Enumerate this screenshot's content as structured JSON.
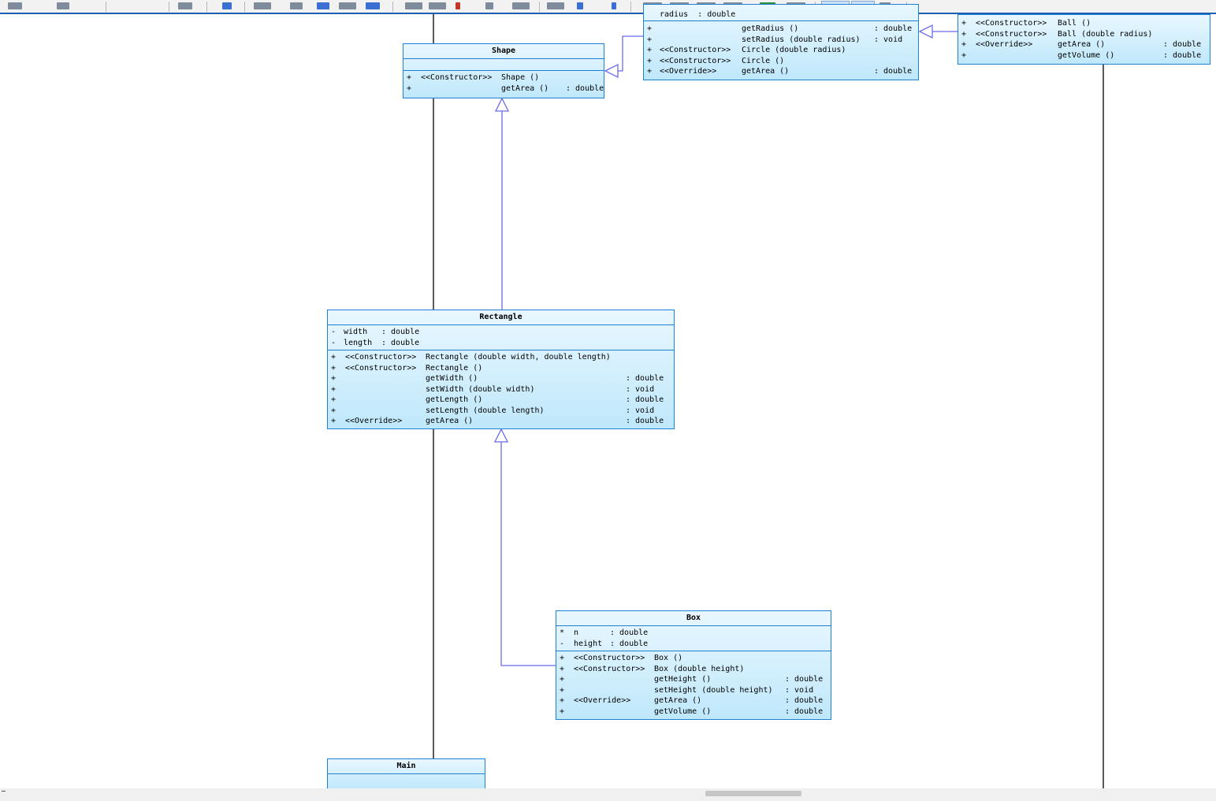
{
  "colors": {
    "class_border": "#1e7fd6",
    "class_fill_top": "#e9f7ff",
    "class_fill_bottom": "#bfe8fb",
    "inheritance_line": "#6b6bea",
    "lifeline": "#000000"
  },
  "classes": {
    "shape": {
      "name": "Shape",
      "attributes": [],
      "operations": [
        {
          "vis": "+",
          "stereo": "<<Constructor>>",
          "sig": "Shape ()",
          "type": ""
        },
        {
          "vis": "+",
          "stereo": "",
          "sig": "getArea ()",
          "type": ": double"
        }
      ]
    },
    "circle": {
      "name": "",
      "partial_attribute": "radius  : double",
      "operations": [
        {
          "vis": "+",
          "stereo": "",
          "sig": "getRadius ()",
          "type": ": double"
        },
        {
          "vis": "+",
          "stereo": "",
          "sig": "setRadius (double radius)",
          "type": ": void"
        },
        {
          "vis": "+",
          "stereo": "<<Constructor>>",
          "sig": "Circle (double radius)",
          "type": ""
        },
        {
          "vis": "+",
          "stereo": "<<Constructor>>",
          "sig": "Circle ()",
          "type": ""
        },
        {
          "vis": "+",
          "stereo": "<<Override>>",
          "sig": "getArea ()",
          "type": ": double"
        }
      ]
    },
    "ball": {
      "name": "",
      "operations": [
        {
          "vis": "+",
          "stereo": "<<Constructor>>",
          "sig": "Ball ()",
          "type": ""
        },
        {
          "vis": "+",
          "stereo": "<<Constructor>>",
          "sig": "Ball (double radius)",
          "type": ""
        },
        {
          "vis": "+",
          "stereo": "<<Override>>",
          "sig": "getArea ()",
          "type": ": double"
        },
        {
          "vis": "+",
          "stereo": "",
          "sig": "getVolume ()",
          "type": ": double"
        }
      ]
    },
    "rectangle": {
      "name": "Rectangle",
      "attributes": [
        {
          "vis": "-",
          "name": "width",
          "type": ": double"
        },
        {
          "vis": "-",
          "name": "length",
          "type": ": double"
        }
      ],
      "operations": [
        {
          "vis": "+",
          "stereo": "<<Constructor>>",
          "sig": "Rectangle (double width, double length)",
          "type": ""
        },
        {
          "vis": "+",
          "stereo": "<<Constructor>>",
          "sig": "Rectangle ()",
          "type": ""
        },
        {
          "vis": "+",
          "stereo": "",
          "sig": "getWidth ()",
          "type": ": double"
        },
        {
          "vis": "+",
          "stereo": "",
          "sig": "setWidth (double width)",
          "type": ": void"
        },
        {
          "vis": "+",
          "stereo": "",
          "sig": "getLength ()",
          "type": ": double"
        },
        {
          "vis": "+",
          "stereo": "",
          "sig": "setLength (double length)",
          "type": ": void"
        },
        {
          "vis": "+",
          "stereo": "<<Override>>",
          "sig": "getArea ()",
          "type": ": double"
        }
      ]
    },
    "box": {
      "name": "Box",
      "attributes": [
        {
          "vis": "*",
          "name": "n",
          "type": ": double"
        },
        {
          "vis": "-",
          "name": "height",
          "type": ": double"
        }
      ],
      "operations": [
        {
          "vis": "+",
          "stereo": "<<Constructor>>",
          "sig": "Box ()",
          "type": ""
        },
        {
          "vis": "+",
          "stereo": "<<Constructor>>",
          "sig": "Box (double height)",
          "type": ""
        },
        {
          "vis": "+",
          "stereo": "",
          "sig": "getHeight ()",
          "type": ": double"
        },
        {
          "vis": "+",
          "stereo": "",
          "sig": "setHeight (double height)",
          "type": ": void"
        },
        {
          "vis": "+",
          "stereo": "<<Override>>",
          "sig": "getArea ()",
          "type": ": double"
        },
        {
          "vis": "+",
          "stereo": "",
          "sig": "getVolume ()",
          "type": ": double"
        }
      ]
    },
    "main": {
      "name": "Main"
    }
  }
}
